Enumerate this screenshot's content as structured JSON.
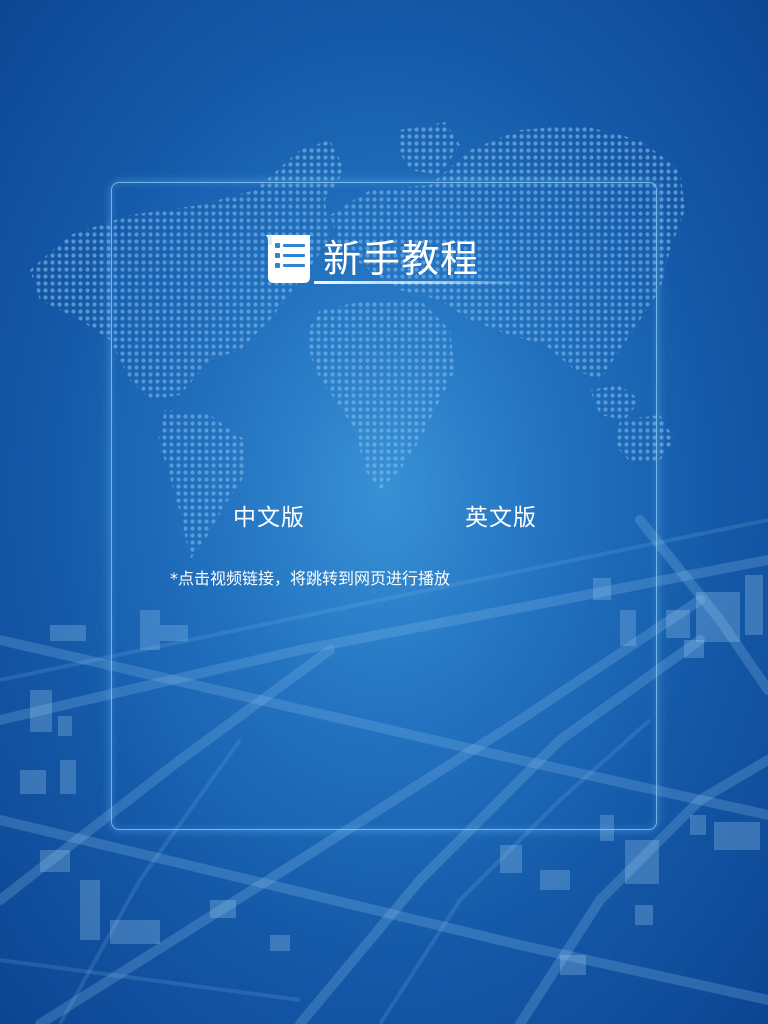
{
  "page": {
    "title": "新手教程"
  },
  "links": {
    "chinese_label": "中文版",
    "english_label": "英文版"
  },
  "note": "*点击视频链接，将跳转到网页进行播放",
  "icons": {
    "title_icon": "list-scroll-icon",
    "background": "world-map-dots-city-grid"
  },
  "colors": {
    "background_center": "#3a94d6",
    "background_edge": "#0c4592",
    "panel_border": "#96d2fa",
    "text": "#ffffff"
  }
}
